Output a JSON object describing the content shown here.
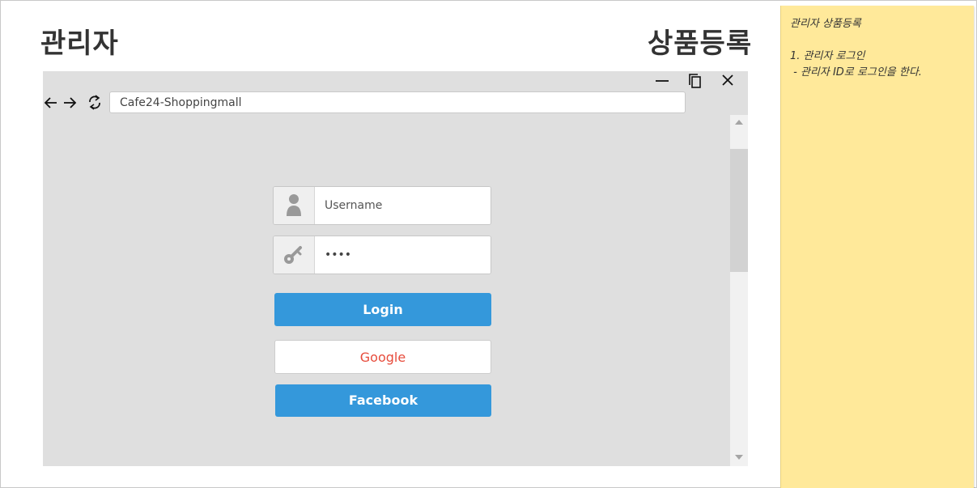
{
  "header": {
    "left_title": "관리자",
    "right_title": "상품등록"
  },
  "browser": {
    "window_controls": {
      "minimize_icon": "minimize-icon",
      "restore_icon": "restore-icon",
      "close_icon": "close-icon"
    },
    "nav_icons": [
      "back-arrow-icon",
      "forward-arrow-icon",
      "refresh-icon"
    ],
    "address": "Cafe24-Shoppingmall"
  },
  "login_form": {
    "username_placeholder": "Username",
    "password_value": "••••",
    "login_label": "Login",
    "google_label": "Google",
    "facebook_label": "Facebook"
  },
  "sticky_note": {
    "title": "관리자 상품등록",
    "line1": "1. 관리자 로그인",
    "line2": " - 관리자 ID로 로그인을 한다."
  },
  "colors": {
    "primary_button": "#3498db",
    "google_text": "#e74c3c",
    "note_background": "#ffe99a",
    "browser_background": "#dfdfdf"
  }
}
